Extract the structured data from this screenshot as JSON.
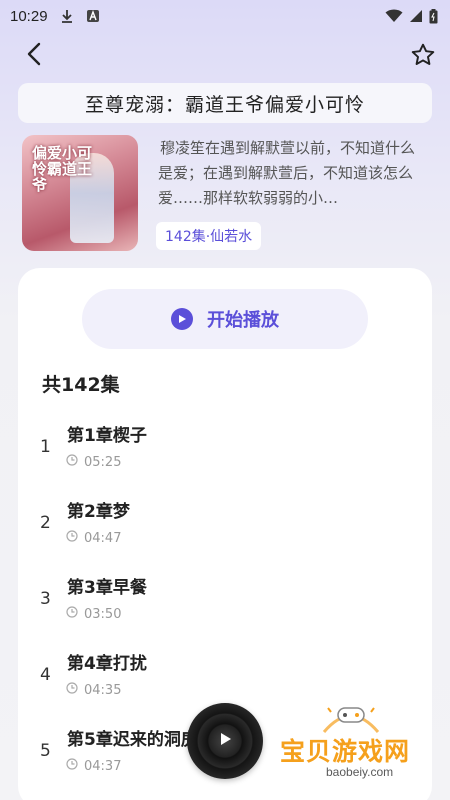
{
  "status_bar": {
    "time": "10:29"
  },
  "nav": {
    "back_icon": "chevron-left-icon",
    "favorite_icon": "star-outline-icon"
  },
  "book": {
    "title": "至尊宠溺：霸道王爷偏爱小可怜",
    "description": "穆凌笙在遇到解默萱以前，不知道什么是爱；在遇到解默萱后，不知道该怎么爱……那样软软弱弱的小…",
    "meta": "142集·仙若水",
    "cover_text": "偏爱小可怜霸道王爷"
  },
  "player": {
    "play_label": "开始播放"
  },
  "episodes": {
    "count_label": "共142集",
    "items": [
      {
        "index": "1",
        "title": "第1章楔子",
        "duration": "05:25"
      },
      {
        "index": "2",
        "title": "第2章梦",
        "duration": "04:47"
      },
      {
        "index": "3",
        "title": "第3章早餐",
        "duration": "03:50"
      },
      {
        "index": "4",
        "title": "第4章打扰",
        "duration": "04:35"
      },
      {
        "index": "5",
        "title": "第5章迟来的洞房",
        "duration": "04:37"
      }
    ]
  },
  "watermark": {
    "name": "宝贝游戏网",
    "url": "baobeiy.com"
  },
  "colors": {
    "accent": "#5b4fd9",
    "watermark_orange": "#f5a01c"
  }
}
